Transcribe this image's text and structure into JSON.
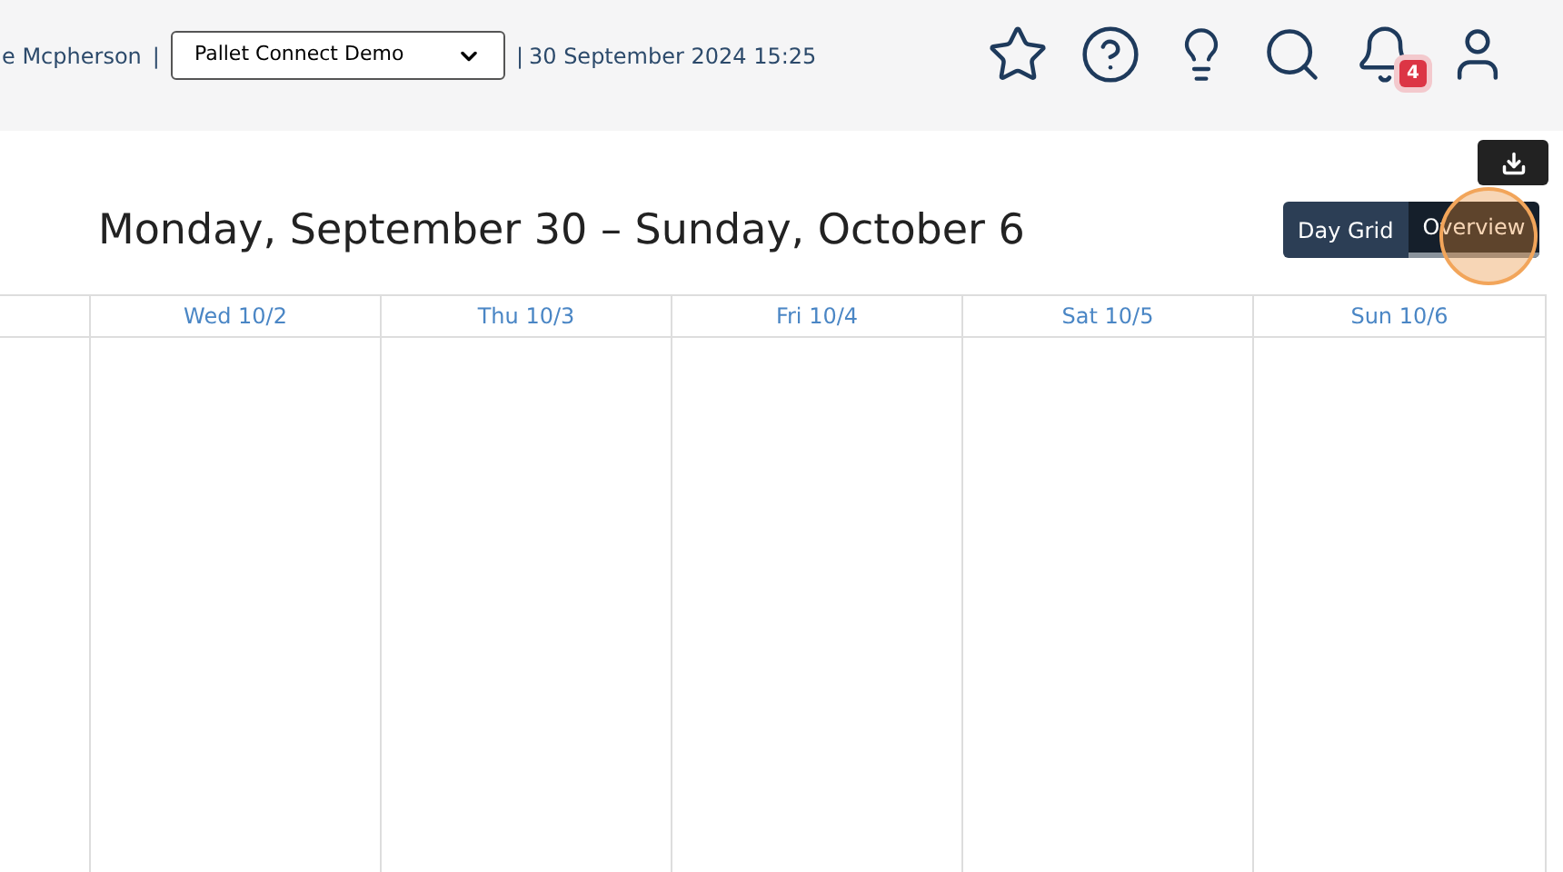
{
  "header": {
    "user_name": "e Mcpherson",
    "separator_left": "|",
    "company_select": {
      "value": "Pallet Connect Demo"
    },
    "separator_right": "|",
    "datetime": "30 September 2024 15:25",
    "notification_count": "4"
  },
  "title": "Monday, September 30 – Sunday, October 6",
  "view_tabs": [
    {
      "label": "Day Grid",
      "selected": false
    },
    {
      "label": "Overview",
      "selected": true
    }
  ],
  "calendar": {
    "columns": [
      "",
      "Wed 10/2",
      "Thu 10/3",
      "Fri 10/4",
      "Sat 10/5",
      "Sun 10/6"
    ]
  }
}
